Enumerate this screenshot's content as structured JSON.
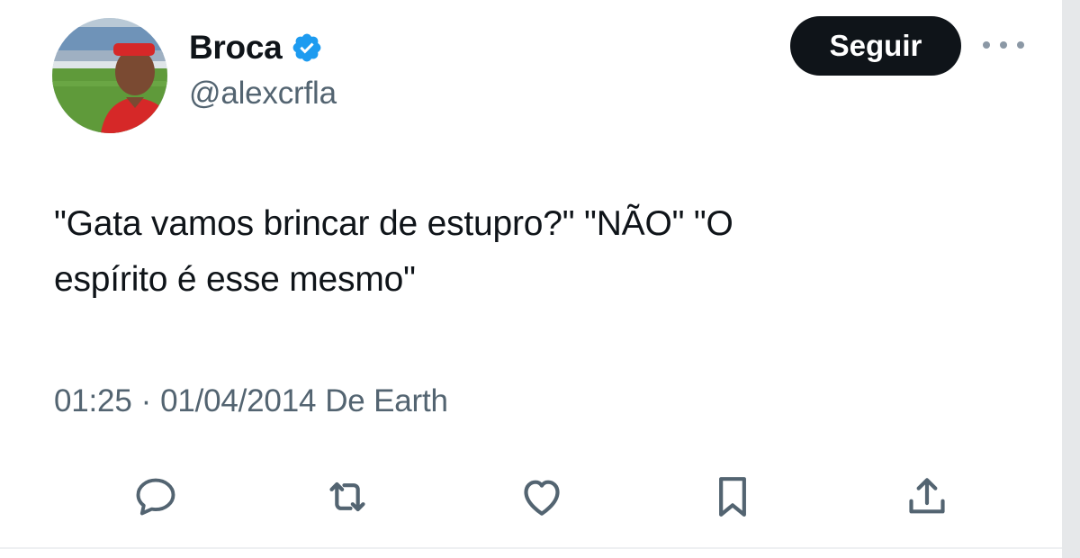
{
  "user": {
    "display_name": "Broca",
    "handle": "@alexcrfla",
    "verified": true,
    "avatar_icon": "profile-photo"
  },
  "header": {
    "follow_label": "Seguir",
    "more_icon": "more-horizontal-icon"
  },
  "tweet": {
    "text_line1": "\"Gata vamos brincar de estupro?\" \"NÃO\" \"O",
    "text_line2": "espírito é esse mesmo\"",
    "time": "01:25",
    "separator": "·",
    "date": "01/04/2014",
    "source": "De Earth"
  },
  "actions": [
    {
      "name": "reply",
      "icon": "reply-icon"
    },
    {
      "name": "retweet",
      "icon": "retweet-icon"
    },
    {
      "name": "like",
      "icon": "heart-icon"
    },
    {
      "name": "bookmark",
      "icon": "bookmark-icon"
    },
    {
      "name": "share",
      "icon": "share-icon"
    }
  ],
  "colors": {
    "text_primary": "#0f1419",
    "text_secondary": "#536471",
    "verified_blue": "#1d9bf0",
    "button_bg": "#0f1419",
    "icon_gray": "#536471"
  }
}
